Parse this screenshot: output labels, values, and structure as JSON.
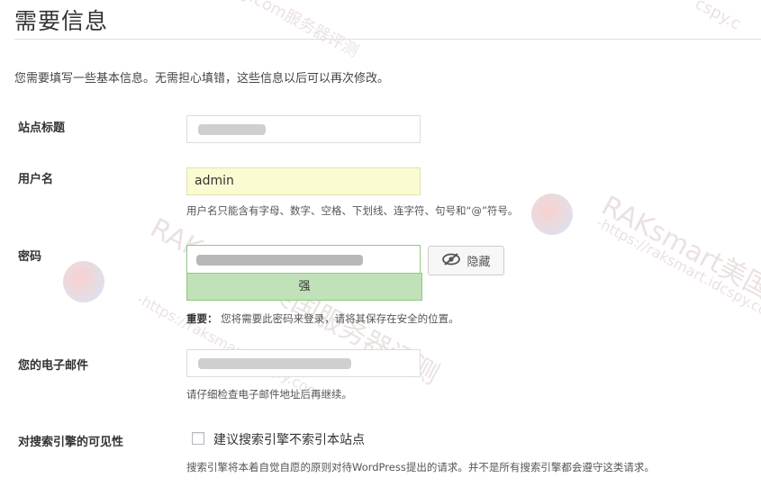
{
  "title": "需要信息",
  "intro": "您需要填写一些基本信息。无需担心填错，这些信息以后可以再次修改。",
  "fields": {
    "site_title": {
      "label": "站点标题"
    },
    "username": {
      "label": "用户名",
      "value": "admin",
      "hint": "用户名只能含有字母、数字、空格、下划线、连字符、句号和“@”符号。"
    },
    "password": {
      "label": "密码",
      "strength": "强",
      "hide_button": "隐藏",
      "hint_bold": "重要：",
      "hint": "您将需要此密码来登录，请将其保存在安全的位置。"
    },
    "email": {
      "label": "您的电子邮件",
      "hint": "请仔细检查电子邮件地址后再继续。"
    },
    "search_visibility": {
      "label": "对搜索引擎的可见性",
      "checkbox_label": "建议搜索引擎不索引本站点",
      "checked": false,
      "hint": "搜索引擎将本着自觉自愿的原则对待WordPress提出的请求。并不是所有搜索引擎都会遵守这类请求。"
    }
  },
  "icons": {
    "hide_password": "eye-slash-icon"
  },
  "colors": {
    "username_bg": "#fbfbd2",
    "strength_bg": "#c1e1b9",
    "strength_border": "#8fc983"
  }
}
